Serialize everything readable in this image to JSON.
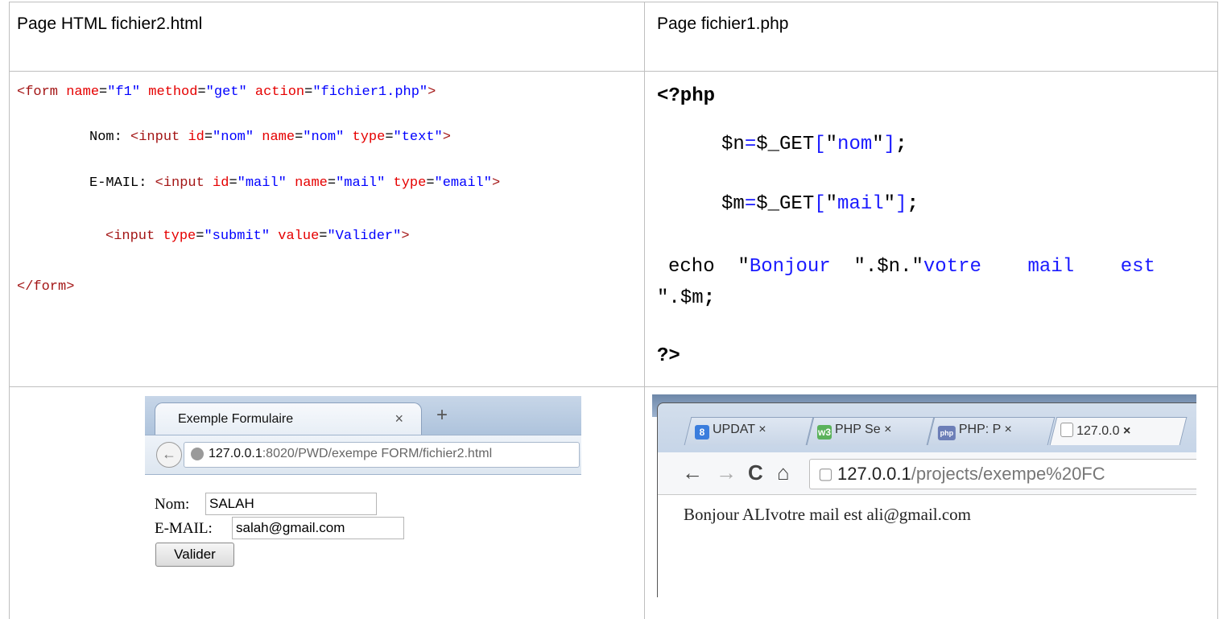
{
  "table": {
    "left_header": "Page HTML fichier2.html",
    "right_header": "Page fichier1.php"
  },
  "html_code": {
    "line1": {
      "open": "<form",
      "a1": "name",
      "v1": "\"f1\"",
      "a2": "method",
      "v2": "\"get\"",
      "a3": "action",
      "v3": "\"fichier1.php\"",
      "close": ">"
    },
    "line2": {
      "label": "Nom: ",
      "open": "<input",
      "a1": "id",
      "v1": "\"nom\"",
      "a2": "name",
      "v2": "\"nom\"",
      "a3": "type",
      "v3": "\"text\"",
      "close": ">"
    },
    "line3": {
      "label": "E-MAIL: ",
      "open": "<input",
      "a1": "id",
      "v1": "\"mail\"",
      "a2": "name",
      "v2": "\"mail\"",
      "a3": "type",
      "v3": "\"email\"",
      "close": ">"
    },
    "line4": {
      "open": "<input",
      "a1": "type",
      "v1": "\"submit\"",
      "a2": "value",
      "v2": "\"Valider\"",
      "close": ">"
    },
    "line5": "</form>"
  },
  "php_code": {
    "open_tag": "<?php",
    "line1": {
      "var": "$n",
      "eq": "=",
      "get": "$_GET",
      "lb": "[",
      "key": "\"nom\"",
      "rb": "]",
      "semi": ";"
    },
    "line2": {
      "var": "$m",
      "eq": "=",
      "get": "$_GET",
      "lb": "[",
      "key": "\"mail\"",
      "rb": "]",
      "semi": ";"
    },
    "echo": {
      "kw": "echo",
      "q1": "\"",
      "s1": "Bonjour",
      "q2": "\".",
      "var1": "$n",
      "dot": ".\"",
      "s2": "votre    mail    est",
      "q3": "\".",
      "var2": "$m",
      "semi": ";"
    },
    "close_tag": "?>"
  },
  "browser_left": {
    "tab_title": "Exemple Formulaire",
    "tab_close": "×",
    "new_tab": "+",
    "back": "←",
    "url_host": "127.0.0.1",
    "url_rest": ":8020/PWD/exempe FORM/fichier2.html",
    "nom_label": "Nom:",
    "nom_value": "SALAH",
    "mail_label": "E-MAIL:",
    "mail_value": "salah@gmail.com",
    "submit_label": "Valider"
  },
  "browser_right": {
    "tabs": [
      {
        "label": "UPDAT",
        "close": "×",
        "favicon": "8",
        "favicon_color": "#3b7ddd"
      },
      {
        "label": "PHP Se",
        "close": "×",
        "favicon": "w3",
        "favicon_color": "#5bb25b"
      },
      {
        "label": "PHP: P",
        "close": "×",
        "favicon": "php",
        "favicon_color": "#6c7eb7"
      },
      {
        "label": "127.0.0",
        "close": "×",
        "favicon": "",
        "favicon_color": ""
      }
    ],
    "back": "←",
    "forward": "→",
    "reload": "C",
    "home": "⌂",
    "url_host": "127.0.0.1",
    "url_rest": "/projects/exempe%20FC",
    "output": "Bonjour ALIvotre mail est ali@gmail.com"
  }
}
